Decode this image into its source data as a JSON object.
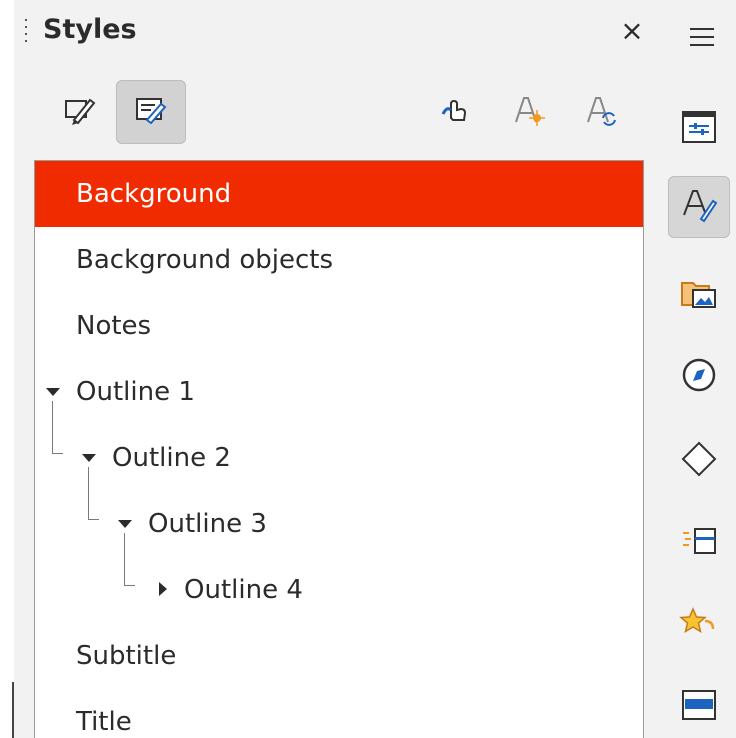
{
  "panel": {
    "title": "Styles",
    "close_glyph": "×"
  },
  "toolbar": {
    "buttons": [
      {
        "icon": "presentation-styles-icon",
        "active": false
      },
      {
        "icon": "drawing-styles-icon",
        "active": true
      },
      {
        "icon": "fill-format-mode-icon",
        "active": false
      },
      {
        "icon": "new-style-from-selection-icon",
        "active": false
      },
      {
        "icon": "update-style-icon",
        "active": false
      }
    ]
  },
  "styles": {
    "items": [
      {
        "label": "Background",
        "selected": true
      },
      {
        "label": "Background objects"
      },
      {
        "label": "Notes"
      },
      {
        "label": "Outline 1"
      },
      {
        "label": "Outline 2"
      },
      {
        "label": "Outline 3"
      },
      {
        "label": "Outline 4"
      },
      {
        "label": "Subtitle"
      },
      {
        "label": "Title"
      }
    ]
  },
  "sidebar": {
    "buttons": [
      {
        "name": "properties-deck-icon"
      },
      {
        "name": "styles-deck-icon",
        "active": true
      },
      {
        "name": "gallery-deck-icon"
      },
      {
        "name": "navigator-deck-icon"
      },
      {
        "name": "shapes-deck-icon"
      },
      {
        "name": "slide-transition-icon"
      },
      {
        "name": "animation-icon"
      },
      {
        "name": "master-slides-icon"
      }
    ]
  },
  "colors": {
    "selection": "#f02b00",
    "panel_bg": "#f2f2f2",
    "accent_blue": "#1d63c0",
    "accent_orange": "#f39a1e"
  }
}
